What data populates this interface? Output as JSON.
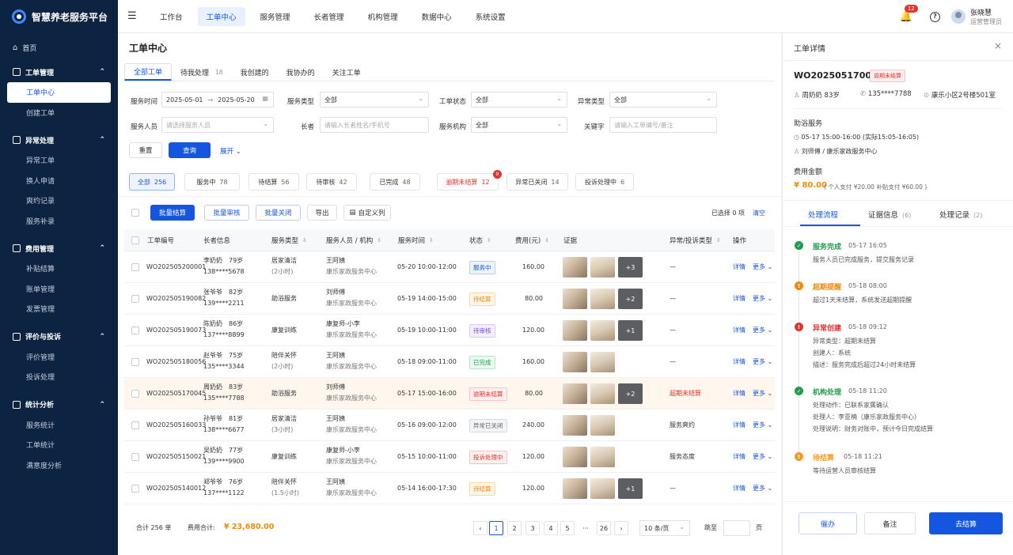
{
  "brand": "智慧养老服务平台",
  "sidebar": {
    "home": "首页",
    "groups": [
      {
        "title": "工单管理",
        "items": [
          "工单中心",
          "创建工单"
        ]
      },
      {
        "title": "异常处理",
        "items": [
          "异常工单",
          "换人申请",
          "爽约记录",
          "服务补录"
        ]
      },
      {
        "title": "费用管理",
        "items": [
          "补贴结算",
          "账单管理",
          "发票管理"
        ]
      },
      {
        "title": "评价与投诉",
        "items": [
          "评价管理",
          "投诉处理"
        ]
      },
      {
        "title": "统计分析",
        "items": [
          "服务统计",
          "工单统计",
          "满意度分析"
        ]
      }
    ]
  },
  "topnav": [
    "工作台",
    "工单中心",
    "服务管理",
    "长者管理",
    "机构管理",
    "数据中心",
    "系统设置"
  ],
  "user": {
    "name": "张晓慧",
    "role": "运营管理员",
    "notifications": "12"
  },
  "page_title": "工单中心",
  "tabs": [
    {
      "label": "全部工单",
      "count": ""
    },
    {
      "label": "待我处理",
      "count": "18"
    },
    {
      "label": "我创建的",
      "count": ""
    },
    {
      "label": "我协办的",
      "count": ""
    },
    {
      "label": "关注工单",
      "count": ""
    }
  ],
  "filters": {
    "service_time_label": "服务时间",
    "date_from": "2025-05-01",
    "date_sep": "→",
    "date_to": "2025-05-20",
    "service_type_label": "服务类型",
    "service_type": "全部",
    "status_label": "工单状态",
    "status": "全部",
    "exception_label": "异常类型",
    "exception": "全部",
    "staff_label": "服务人员",
    "staff_placeholder": "请选择服务人员",
    "elder_label": "长者",
    "elder_placeholder": "请输入长者姓名/手机号",
    "org_label": "服务机构",
    "org": "全部",
    "keyword_label": "关键字",
    "keyword_placeholder": "请输入工单编号/备注",
    "reset": "重置",
    "search": "查询",
    "expand": "展开"
  },
  "stats": [
    {
      "label": "全部",
      "count": "256"
    },
    {
      "label": "服务中",
      "count": "78"
    },
    {
      "label": "待结算",
      "count": "56"
    },
    {
      "label": "待审核",
      "count": "42"
    },
    {
      "label": "已完成",
      "count": "48"
    },
    {
      "label": "逾期未结算",
      "count": "12",
      "badge": "9"
    },
    {
      "label": "异常已关闭",
      "count": "14"
    },
    {
      "label": "投诉处理中",
      "count": "6"
    }
  ],
  "actions": {
    "batch_settle": "批量结算",
    "batch_review": "批量审核",
    "batch_close": "批量关闭",
    "export": "导出",
    "custom_cols": "自定义列",
    "selected": "已选择 0 项",
    "clear": "清空"
  },
  "columns": [
    "工单编号",
    "长者信息",
    "服务类型",
    "服务人员 / 机构",
    "服务时间",
    "状态",
    "费用(元)",
    "证据",
    "异常/投诉类型",
    "操作"
  ],
  "rows": [
    {
      "id": "WO202505200001",
      "elder": "李奶奶",
      "age": "79岁",
      "phone": "138****5678",
      "type": "居家清洁",
      "dur": "(2小时)",
      "staff": "王阿姨",
      "org": "康乐家政服务中心",
      "time": "05-20  10:00-12:00",
      "status": "服务中",
      "st": "t-blue",
      "fee": "160.00",
      "ev": 3,
      "more": "+3",
      "exc": "—"
    },
    {
      "id": "WO202505190082",
      "elder": "张爷爷",
      "age": "82岁",
      "phone": "139****2211",
      "type": "助浴服务",
      "dur": "",
      "staff": "刘师傅",
      "org": "康乐家政服务中心",
      "time": "05-19  14:00-15:00",
      "status": "待结算",
      "st": "t-orange",
      "fee": "80.00",
      "ev": 3,
      "more": "+2",
      "exc": "—"
    },
    {
      "id": "WO202505190073",
      "elder": "陈奶奶",
      "age": "86岁",
      "phone": "137****8899",
      "type": "康复训练",
      "dur": "",
      "staff": "康复师-小李",
      "org": "康乐家政服务中心",
      "time": "05-19  10:00-11:00",
      "status": "待审核",
      "st": "t-purple",
      "fee": "120.00",
      "ev": 3,
      "more": "+1",
      "exc": "—"
    },
    {
      "id": "WO202505180056",
      "elder": "赵爷爷",
      "age": "75岁",
      "phone": "135****3344",
      "type": "陪伴关怀",
      "dur": "(2小时)",
      "staff": "王阿姨",
      "org": "康乐家政服务中心",
      "time": "05-18  09:00-11:00",
      "status": "已完成",
      "st": "t-green",
      "fee": "160.00",
      "ev": 2,
      "more": "",
      "exc": "—"
    },
    {
      "id": "WO202505170045",
      "elder": "周奶奶",
      "age": "83岁",
      "phone": "135****7788",
      "type": "助浴服务",
      "dur": "",
      "staff": "刘师傅",
      "org": "康乐家政服务中心",
      "time": "05-17  15:00-16:00",
      "status": "逾期未结算",
      "st": "t-red",
      "fee": "80.00",
      "ev": 3,
      "more": "+2",
      "exc": "超期未结算",
      "hl": true
    },
    {
      "id": "WO202505160033",
      "elder": "孙爷爷",
      "age": "81岁",
      "phone": "138****6677",
      "type": "居家清洁",
      "dur": "(3小时)",
      "staff": "王阿姨",
      "org": "康乐家政服务中心",
      "time": "05-16  09:00-12:00",
      "status": "异常已关闭",
      "st": "t-gray",
      "fee": "240.00",
      "ev": 2,
      "more": "",
      "exc": "服务爽约"
    },
    {
      "id": "WO202505150021",
      "elder": "吴奶奶",
      "age": "77岁",
      "phone": "139****9900",
      "type": "康复训练",
      "dur": "",
      "staff": "康复师-小李",
      "org": "康乐家政服务中心",
      "time": "05-15  10:00-11:00",
      "status": "投诉处理中",
      "st": "t-red",
      "fee": "120.00",
      "ev": 2,
      "more": "",
      "exc": "服务态度"
    },
    {
      "id": "WO202505140012",
      "elder": "郑爷爷",
      "age": "76岁",
      "phone": "137****1122",
      "type": "陪伴关怀",
      "dur": "(1.5小时)",
      "staff": "王阿姨",
      "org": "康乐家政服务中心",
      "time": "05-14  16:00-17:30",
      "status": "待结算",
      "st": "t-orange",
      "fee": "120.00",
      "ev": 3,
      "more": "+1",
      "exc": "—"
    }
  ],
  "row_ops": {
    "detail": "详情",
    "more": "更多"
  },
  "footer": {
    "total": "合计 256 单",
    "fee_label": "费用合计:",
    "fee": "¥ 23,680.00",
    "pages": [
      "1",
      "2",
      "3",
      "4",
      "5",
      "···",
      "26"
    ],
    "page_size": "10 条/页",
    "jump": "跳至",
    "page_unit": "页"
  },
  "detail": {
    "title": "工单详情",
    "id": "WO202505170045",
    "tag": "逾期未结算",
    "elder": "周奶奶  83岁",
    "phone": "135****7788",
    "addr": "康乐小区2号楼501室",
    "service": "助浴服务",
    "time": "05-17 15:00-16:00 (实际15:05-16:05)",
    "staff": "刘师傅 / 康乐家政服务中心",
    "fee_title": "费用金额",
    "fee": "¥ 80.00",
    "fee_note": "( 个人支付 ¥20.00    补贴支付 ¥60.00 )",
    "tabs": [
      {
        "label": "处理流程",
        "count": ""
      },
      {
        "label": "证据信息",
        "count": "(6)"
      },
      {
        "label": "处理记录",
        "count": "(2)"
      }
    ],
    "timeline": [
      {
        "title": "服务完成",
        "time": "05-17 16:05",
        "color": "#1f9d4c",
        "lines": [
          "服务人员已完成服务，提交服务记录"
        ]
      },
      {
        "title": "超期提醒",
        "time": "05-18 08:00",
        "color": "#f08a0d",
        "lines": [
          "超过1天未结算，系统发送超期提醒"
        ]
      },
      {
        "title": "异常创建",
        "time": "05-18 09:12",
        "color": "#e5322d",
        "lines": [
          "异常类型：超期未结算",
          "创建人：系统",
          "描述：服务完成后超过24小时未结算"
        ]
      },
      {
        "title": "机构处理",
        "time": "05-18 11:20",
        "color": "#1f9d4c",
        "lines": [
          "处理动作：已联系家属确认",
          "处理人：李亚楠（康乐家政服务中心）",
          "处理说明：财务对账中，预计今日完成结算"
        ]
      },
      {
        "title": "待结算",
        "time": "05-18 11:21",
        "color": "#f59a23",
        "lines": [
          "等待运营人员审核结算"
        ]
      }
    ],
    "buttons": {
      "urge": "催办",
      "note": "备注",
      "settle": "去结算"
    }
  }
}
